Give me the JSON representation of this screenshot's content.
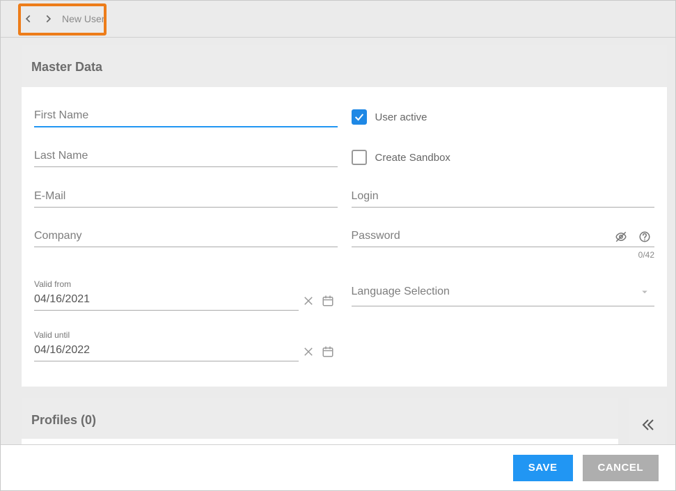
{
  "breadcrumb": {
    "title": "New User"
  },
  "master": {
    "title": "Master Data",
    "fields": {
      "first_name_label": "First Name",
      "last_name_label": "Last Name",
      "email_label": "E-Mail",
      "company_label": "Company",
      "login_label": "Login",
      "valid_from_label": "Valid from",
      "valid_from_value": "04/16/2021",
      "valid_until_label": "Valid until",
      "valid_until_value": "04/16/2022",
      "user_active_label": "User active",
      "user_active_checked": true,
      "create_sandbox_label": "Create Sandbox",
      "create_sandbox_checked": false,
      "password_label": "Password",
      "password_counter": "0/42",
      "language_label": "Language Selection"
    }
  },
  "profiles": {
    "title": "Profiles (0)"
  },
  "footer": {
    "save": "SAVE",
    "cancel": "CANCEL"
  }
}
